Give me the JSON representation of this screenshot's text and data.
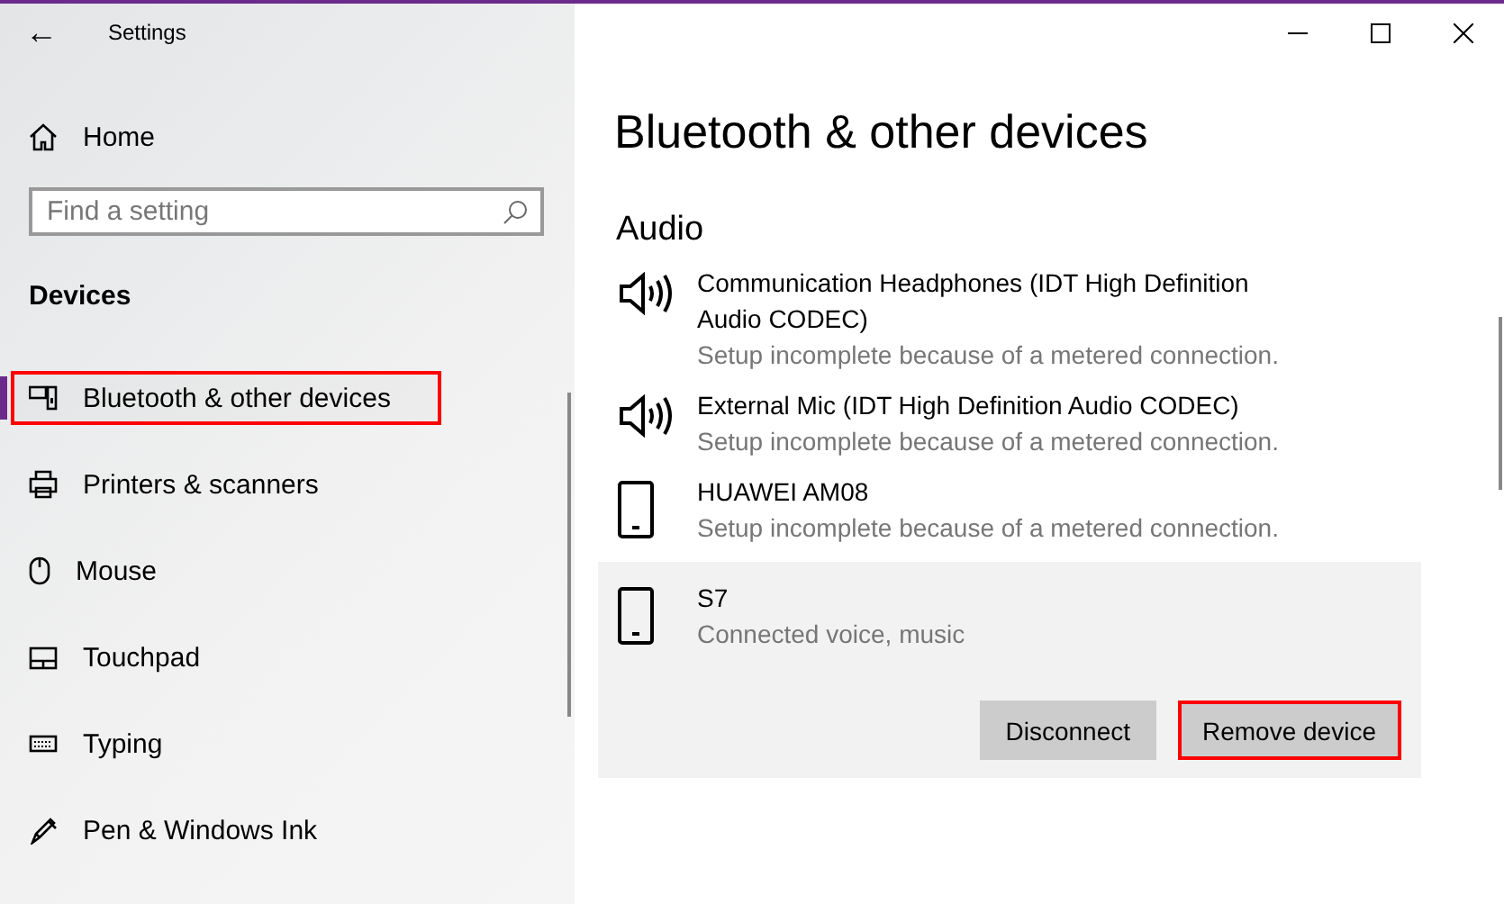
{
  "window": {
    "title": "Settings",
    "back": "←"
  },
  "sidebar": {
    "home": "Home",
    "search": {
      "placeholder": "Find a setting"
    },
    "section": "Devices",
    "items": [
      {
        "label": "Bluetooth & other devices",
        "selected": true,
        "highlighted": true
      },
      {
        "label": "Printers & scanners",
        "selected": false,
        "highlighted": false
      },
      {
        "label": "Mouse",
        "selected": false,
        "highlighted": false
      },
      {
        "label": "Touchpad",
        "selected": false,
        "highlighted": false
      },
      {
        "label": "Typing",
        "selected": false,
        "highlighted": false
      },
      {
        "label": "Pen & Windows Ink",
        "selected": false,
        "highlighted": false
      }
    ]
  },
  "page": {
    "title": "Bluetooth & other devices",
    "section": "Audio",
    "devices": [
      {
        "kind": "speaker",
        "name": "Communication Headphones (IDT High Definition Audio CODEC)",
        "status": "Setup incomplete because of a metered connection.",
        "expanded": false
      },
      {
        "kind": "speaker",
        "name": "External Mic (IDT High Definition Audio CODEC)",
        "status": "Setup incomplete because of a metered connection.",
        "expanded": false
      },
      {
        "kind": "phone",
        "name": "HUAWEI AM08",
        "status": "Setup incomplete because of a metered connection.",
        "expanded": false
      },
      {
        "kind": "phone",
        "name": "S7",
        "status": "Connected voice, music",
        "expanded": true,
        "actions": [
          {
            "label": "Disconnect",
            "highlighted": false
          },
          {
            "label": "Remove device",
            "highlighted": true
          }
        ]
      }
    ]
  }
}
